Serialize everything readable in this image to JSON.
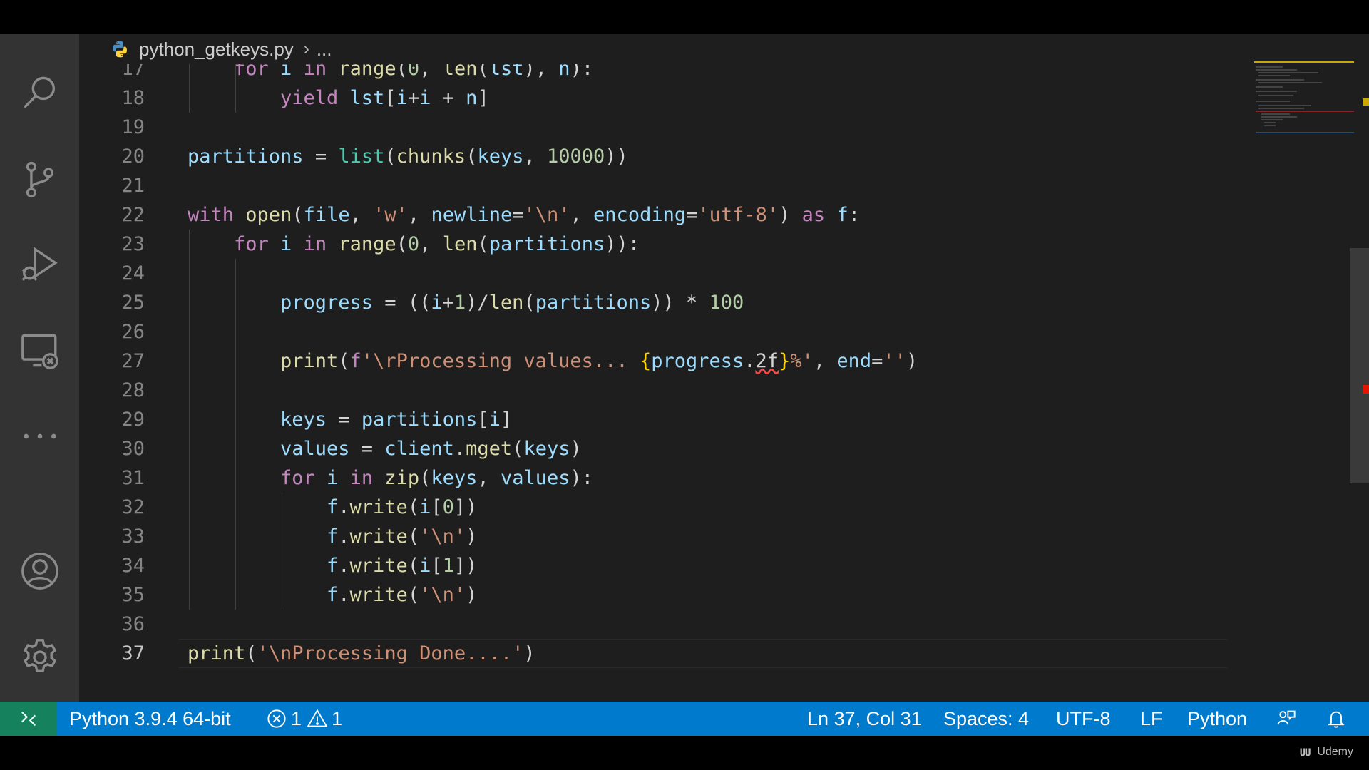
{
  "breadcrumb": {
    "file": "python_getkeys.py",
    "trail": "..."
  },
  "activity_bar": {
    "icons": [
      "search-icon",
      "source-control-icon",
      "run-debug-icon",
      "remote-explorer-icon",
      "more-icon",
      "account-icon",
      "settings-gear-icon"
    ]
  },
  "editor": {
    "active_line": "37",
    "lines": [
      {
        "num": "17",
        "partial": true,
        "indent": 1,
        "tokens": [
          [
            "kw",
            "for"
          ],
          [
            "op",
            " "
          ],
          [
            "var",
            "i"
          ],
          [
            "op",
            " "
          ],
          [
            "kw",
            "in"
          ],
          [
            "op",
            " "
          ],
          [
            "fn",
            "range"
          ],
          [
            "op",
            "("
          ],
          [
            "num",
            "0"
          ],
          [
            "op",
            ", "
          ],
          [
            "fn",
            "len"
          ],
          [
            "op",
            "("
          ],
          [
            "var",
            "lst"
          ],
          [
            "op",
            "), "
          ],
          [
            "var",
            "n"
          ],
          [
            "op",
            "):"
          ]
        ]
      },
      {
        "num": "18",
        "indent": 2,
        "tokens": [
          [
            "kw",
            "yield"
          ],
          [
            "op",
            " "
          ],
          [
            "var",
            "lst"
          ],
          [
            "op",
            "["
          ],
          [
            "var",
            "i"
          ],
          [
            "op",
            "+"
          ],
          [
            "var",
            "i"
          ],
          [
            "op",
            " + "
          ],
          [
            "var",
            "n"
          ],
          [
            "op",
            "]"
          ]
        ]
      },
      {
        "num": "19",
        "indent": 0,
        "tokens": []
      },
      {
        "num": "20",
        "indent": 0,
        "tokens": [
          [
            "var",
            "partitions"
          ],
          [
            "op",
            " = "
          ],
          [
            "cls",
            "list"
          ],
          [
            "op",
            "("
          ],
          [
            "fn",
            "chunks"
          ],
          [
            "op",
            "("
          ],
          [
            "var",
            "keys"
          ],
          [
            "op",
            ", "
          ],
          [
            "num",
            "10000"
          ],
          [
            "op",
            "))"
          ]
        ]
      },
      {
        "num": "21",
        "indent": 0,
        "tokens": []
      },
      {
        "num": "22",
        "indent": 0,
        "tokens": [
          [
            "kw",
            "with"
          ],
          [
            "op",
            " "
          ],
          [
            "fn",
            "open"
          ],
          [
            "op",
            "("
          ],
          [
            "var",
            "file"
          ],
          [
            "op",
            ", "
          ],
          [
            "str",
            "'w'"
          ],
          [
            "op",
            ", "
          ],
          [
            "var",
            "newline"
          ],
          [
            "op",
            "="
          ],
          [
            "str",
            "'\\n'"
          ],
          [
            "op",
            ", "
          ],
          [
            "var",
            "encoding"
          ],
          [
            "op",
            "="
          ],
          [
            "str",
            "'utf-8'"
          ],
          [
            "op",
            ") "
          ],
          [
            "kw",
            "as"
          ],
          [
            "op",
            " "
          ],
          [
            "var",
            "f"
          ],
          [
            "op",
            ":"
          ]
        ]
      },
      {
        "num": "23",
        "indent": 1,
        "tokens": [
          [
            "kw",
            "for"
          ],
          [
            "op",
            " "
          ],
          [
            "var",
            "i"
          ],
          [
            "op",
            " "
          ],
          [
            "kw",
            "in"
          ],
          [
            "op",
            " "
          ],
          [
            "fn",
            "range"
          ],
          [
            "op",
            "("
          ],
          [
            "num",
            "0"
          ],
          [
            "op",
            ", "
          ],
          [
            "fn",
            "len"
          ],
          [
            "op",
            "("
          ],
          [
            "var",
            "partitions"
          ],
          [
            "op",
            "))"
          ],
          [
            "op",
            ":"
          ]
        ]
      },
      {
        "num": "24",
        "indent": 0,
        "tokens": []
      },
      {
        "num": "25",
        "indent": 2,
        "tokens": [
          [
            "var",
            "progress"
          ],
          [
            "op",
            " = (("
          ],
          [
            "var",
            "i"
          ],
          [
            "op",
            "+"
          ],
          [
            "num",
            "1"
          ],
          [
            "op",
            ")/"
          ],
          [
            "fn",
            "len"
          ],
          [
            "op",
            "("
          ],
          [
            "var",
            "partitions"
          ],
          [
            "op",
            ")) * "
          ],
          [
            "num",
            "100"
          ]
        ]
      },
      {
        "num": "26",
        "indent": 0,
        "tokens": []
      },
      {
        "num": "27",
        "indent": 2,
        "tokens": [
          [
            "fn",
            "print"
          ],
          [
            "op",
            "("
          ],
          [
            "kw",
            "f"
          ],
          [
            "str",
            "'\\rProcessing values... "
          ],
          [
            "br1",
            "{"
          ],
          [
            "var",
            "progress"
          ],
          [
            "op",
            "."
          ],
          [
            "squig",
            "2f"
          ],
          [
            "br1",
            "}"
          ],
          [
            "str",
            "%'"
          ],
          [
            "op",
            ", "
          ],
          [
            "var",
            "end"
          ],
          [
            "op",
            "="
          ],
          [
            "str",
            "''"
          ],
          [
            "op",
            ")"
          ]
        ]
      },
      {
        "num": "28",
        "indent": 0,
        "tokens": []
      },
      {
        "num": "29",
        "indent": 2,
        "tokens": [
          [
            "var",
            "keys"
          ],
          [
            "op",
            " = "
          ],
          [
            "var",
            "partitions"
          ],
          [
            "op",
            "["
          ],
          [
            "var",
            "i"
          ],
          [
            "op",
            "]"
          ]
        ]
      },
      {
        "num": "30",
        "indent": 2,
        "tokens": [
          [
            "var",
            "values"
          ],
          [
            "op",
            " = "
          ],
          [
            "var",
            "client"
          ],
          [
            "op",
            "."
          ],
          [
            "fn",
            "mget"
          ],
          [
            "op",
            "("
          ],
          [
            "var",
            "keys"
          ],
          [
            "op",
            ")"
          ]
        ]
      },
      {
        "num": "31",
        "indent": 2,
        "tokens": [
          [
            "kw",
            "for"
          ],
          [
            "op",
            " "
          ],
          [
            "var",
            "i"
          ],
          [
            "op",
            " "
          ],
          [
            "kw",
            "in"
          ],
          [
            "op",
            " "
          ],
          [
            "fn",
            "zip"
          ],
          [
            "op",
            "("
          ],
          [
            "var",
            "keys"
          ],
          [
            "op",
            ", "
          ],
          [
            "var",
            "values"
          ],
          [
            "op",
            "):"
          ]
        ]
      },
      {
        "num": "32",
        "indent": 3,
        "tokens": [
          [
            "var",
            "f"
          ],
          [
            "op",
            "."
          ],
          [
            "fn",
            "write"
          ],
          [
            "op",
            "("
          ],
          [
            "var",
            "i"
          ],
          [
            "op",
            "["
          ],
          [
            "num",
            "0"
          ],
          [
            "op",
            "])"
          ]
        ]
      },
      {
        "num": "33",
        "indent": 3,
        "tokens": [
          [
            "var",
            "f"
          ],
          [
            "op",
            "."
          ],
          [
            "fn",
            "write"
          ],
          [
            "op",
            "("
          ],
          [
            "str",
            "'\\n'"
          ],
          [
            "op",
            ")"
          ]
        ]
      },
      {
        "num": "34",
        "indent": 3,
        "tokens": [
          [
            "var",
            "f"
          ],
          [
            "op",
            "."
          ],
          [
            "fn",
            "write"
          ],
          [
            "op",
            "("
          ],
          [
            "var",
            "i"
          ],
          [
            "op",
            "["
          ],
          [
            "num",
            "1"
          ],
          [
            "op",
            "])"
          ]
        ]
      },
      {
        "num": "35",
        "indent": 3,
        "tokens": [
          [
            "var",
            "f"
          ],
          [
            "op",
            "."
          ],
          [
            "fn",
            "write"
          ],
          [
            "op",
            "("
          ],
          [
            "str",
            "'\\n'"
          ],
          [
            "op",
            ")"
          ]
        ]
      },
      {
        "num": "36",
        "indent": 0,
        "tokens": []
      },
      {
        "num": "37",
        "indent": 0,
        "tokens": [
          [
            "fn",
            "print"
          ],
          [
            "op",
            "("
          ],
          [
            "str",
            "'\\nProcessing Done....'"
          ],
          [
            "op",
            ")"
          ]
        ]
      }
    ]
  },
  "status_bar": {
    "interpreter": "Python 3.9.4 64-bit",
    "errors": "1",
    "warnings": "1",
    "cursor": "Ln 37, Col 31",
    "spaces": "Spaces: 4",
    "encoding": "UTF-8",
    "eol": "LF",
    "language": "Python"
  },
  "watermark": "Udemy",
  "colors": {
    "status_bar": "#007acc",
    "remote_indicator": "#16825d",
    "editor_bg": "#1e1e1e",
    "activity_bar": "#333333"
  }
}
